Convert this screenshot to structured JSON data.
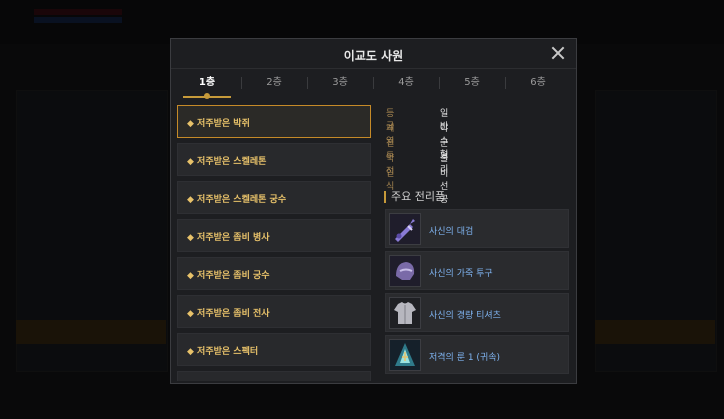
{
  "modal": {
    "title": "이교도 사원"
  },
  "tabs": [
    {
      "label": "1층",
      "active": true
    },
    {
      "label": "2층",
      "active": false
    },
    {
      "label": "3층",
      "active": false
    },
    {
      "label": "4층",
      "active": false
    },
    {
      "label": "5층",
      "active": false
    },
    {
      "label": "6층",
      "active": false
    }
  ],
  "monsters": [
    {
      "label": "◆ 저주받은 박쥐",
      "selected": true
    },
    {
      "label": "◆ 저주받은 스켈레톤",
      "selected": false
    },
    {
      "label": "◆ 저주받은 스켈레톤 궁수",
      "selected": false
    },
    {
      "label": "◆ 저주받은 좀비 병사",
      "selected": false
    },
    {
      "label": "◆ 저주받은 좀비 궁수",
      "selected": false
    },
    {
      "label": "◆ 저주받은 좀비 전사",
      "selected": false
    },
    {
      "label": "◆ 저주받은 스펙터",
      "selected": false
    }
  ],
  "info": {
    "grade_label": "등급",
    "grade_value": "일반",
    "family_label": "계열",
    "family_value": "야수형",
    "combat_label": "전투",
    "combat_value": "근거리",
    "weakness_label": "약점",
    "weakness_value": "불",
    "recognition_label": "인식",
    "recognition_value": "비선공"
  },
  "drops_title": "주요 전리품",
  "drops": [
    {
      "name": "사신의 대검",
      "icon": "sword-icon"
    },
    {
      "name": "사신의 가죽 투구",
      "icon": "helmet-icon"
    },
    {
      "name": "사신의 경량 티셔츠",
      "icon": "shirt-icon"
    },
    {
      "name": "저격의 룬 1 (귀속)",
      "icon": "rune-icon"
    }
  ],
  "colors": {
    "accent": "#c69a3a",
    "monster_text": "#e8c26a",
    "item_name": "#7fb3f0",
    "label": "#a58550"
  }
}
